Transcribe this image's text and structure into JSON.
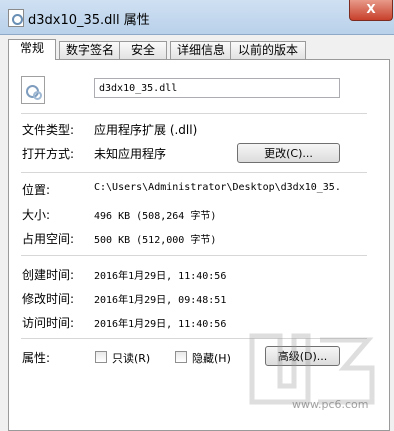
{
  "window": {
    "title": "d3dx10_35.dll 属性",
    "close_label": "X"
  },
  "tabs": [
    {
      "label": "常规",
      "active": true
    },
    {
      "label": "数字签名",
      "active": false
    },
    {
      "label": "安全",
      "active": false
    },
    {
      "label": "详细信息",
      "active": false
    },
    {
      "label": "以前的版本",
      "active": false
    }
  ],
  "general": {
    "file_name": "d3dx10_35.dll",
    "file_type_label": "文件类型:",
    "file_type_value": "应用程序扩展 (.dll)",
    "open_with_label": "打开方式:",
    "open_with_value": "未知应用程序",
    "change_button": "更改(C)...",
    "location_label": "位置:",
    "location_value": "C:\\Users\\Administrator\\Desktop\\d3dx10_35.",
    "size_label": "大小:",
    "size_value": "496 KB (508,264 字节)",
    "size_on_disk_label": "占用空间:",
    "size_on_disk_value": "500 KB (512,000 字节)",
    "created_label": "创建时间:",
    "created_value": "2016年1月29日, 11:40:56",
    "modified_label": "修改时间:",
    "modified_value": "2016年1月29日, 09:48:51",
    "accessed_label": "访问时间:",
    "accessed_value": "2016年1月29日, 11:40:56",
    "attributes_label": "属性:",
    "readonly_label": "只读(R)",
    "hidden_label": "隐藏(H)",
    "advanced_button": "高级(D)..."
  },
  "watermark": {
    "text": "www.pc6.com"
  }
}
